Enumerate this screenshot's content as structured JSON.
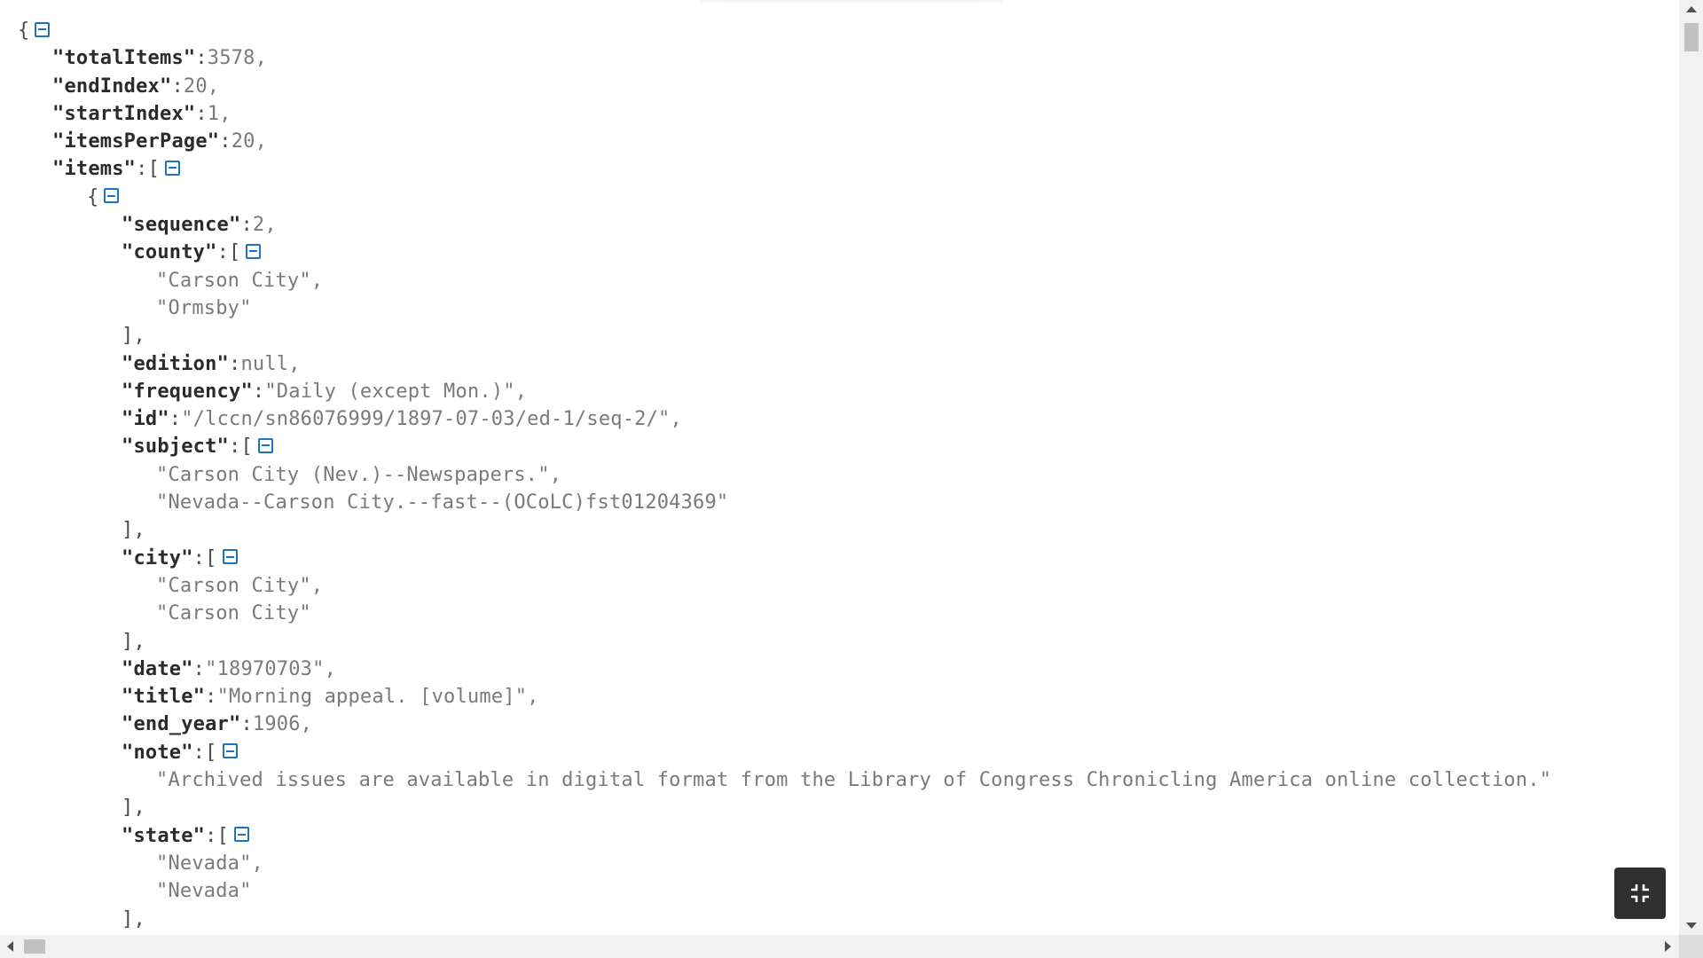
{
  "json_view": {
    "lines": [
      {
        "indent": 0,
        "k": "",
        "colon": "",
        "v": "{",
        "toggle": true
      },
      {
        "indent": 1,
        "k": "\"totalItems\"",
        "colon": ":",
        "v": "3578,",
        "toggle": false
      },
      {
        "indent": 1,
        "k": "\"endIndex\"",
        "colon": ":",
        "v": "20,",
        "toggle": false
      },
      {
        "indent": 1,
        "k": "\"startIndex\"",
        "colon": ":",
        "v": "1,",
        "toggle": false
      },
      {
        "indent": 1,
        "k": "\"itemsPerPage\"",
        "colon": ":",
        "v": "20,",
        "toggle": false
      },
      {
        "indent": 1,
        "k": "\"items\"",
        "colon": ":",
        "v": "[",
        "toggle": true
      },
      {
        "indent": 2,
        "k": "",
        "colon": "",
        "v": "{",
        "toggle": true
      },
      {
        "indent": 3,
        "k": "\"sequence\"",
        "colon": ":",
        "v": "2,",
        "toggle": false
      },
      {
        "indent": 3,
        "k": "\"county\"",
        "colon": ":",
        "v": "[",
        "toggle": true
      },
      {
        "indent": 4,
        "k": "",
        "colon": "",
        "v": "\"Carson City\",",
        "toggle": false
      },
      {
        "indent": 4,
        "k": "",
        "colon": "",
        "v": "\"Ormsby\"",
        "toggle": false
      },
      {
        "indent": 3,
        "k": "",
        "colon": "",
        "v": "],",
        "toggle": false
      },
      {
        "indent": 3,
        "k": "\"edition\"",
        "colon": ":",
        "v": "null,",
        "toggle": false
      },
      {
        "indent": 3,
        "k": "\"frequency\"",
        "colon": ":",
        "v": "\"Daily (except Mon.)\",",
        "toggle": false
      },
      {
        "indent": 3,
        "k": "\"id\"",
        "colon": ":",
        "v": "\"/lccn/sn86076999/1897-07-03/ed-1/seq-2/\",",
        "toggle": false
      },
      {
        "indent": 3,
        "k": "\"subject\"",
        "colon": ":",
        "v": "[",
        "toggle": true
      },
      {
        "indent": 4,
        "k": "",
        "colon": "",
        "v": "\"Carson City (Nev.)--Newspapers.\",",
        "toggle": false
      },
      {
        "indent": 4,
        "k": "",
        "colon": "",
        "v": "\"Nevada--Carson City.--fast--(OCoLC)fst01204369\"",
        "toggle": false
      },
      {
        "indent": 3,
        "k": "",
        "colon": "",
        "v": "],",
        "toggle": false
      },
      {
        "indent": 3,
        "k": "\"city\"",
        "colon": ":",
        "v": "[",
        "toggle": true
      },
      {
        "indent": 4,
        "k": "",
        "colon": "",
        "v": "\"Carson City\",",
        "toggle": false
      },
      {
        "indent": 4,
        "k": "",
        "colon": "",
        "v": "\"Carson City\"",
        "toggle": false
      },
      {
        "indent": 3,
        "k": "",
        "colon": "",
        "v": "],",
        "toggle": false
      },
      {
        "indent": 3,
        "k": "\"date\"",
        "colon": ":",
        "v": "\"18970703\",",
        "toggle": false
      },
      {
        "indent": 3,
        "k": "\"title\"",
        "colon": ":",
        "v": "\"Morning appeal. [volume]\",",
        "toggle": false
      },
      {
        "indent": 3,
        "k": "\"end_year\"",
        "colon": ":",
        "v": "1906,",
        "toggle": false
      },
      {
        "indent": 3,
        "k": "\"note\"",
        "colon": ":",
        "v": "[",
        "toggle": true
      },
      {
        "indent": 4,
        "k": "",
        "colon": "",
        "v": "\"Archived issues are available in digital format from the Library of Congress Chronicling America online collection.\"",
        "toggle": false
      },
      {
        "indent": 3,
        "k": "",
        "colon": "",
        "v": "],",
        "toggle": false
      },
      {
        "indent": 3,
        "k": "\"state\"",
        "colon": ":",
        "v": "[",
        "toggle": true
      },
      {
        "indent": 4,
        "k": "",
        "colon": "",
        "v": "\"Nevada\",",
        "toggle": false
      },
      {
        "indent": 4,
        "k": "",
        "colon": "",
        "v": "\"Nevada\"",
        "toggle": false
      },
      {
        "indent": 3,
        "k": "",
        "colon": "",
        "v": "],",
        "toggle": false
      }
    ]
  },
  "controls": {
    "collapse_icon": "minus-square-icon",
    "exit_fullscreen_icon": "exit-fullscreen-icon"
  },
  "colors": {
    "key": "#2b2b2b",
    "value": "#7a7a7a",
    "toggle": "#1e73be",
    "fullscreen_button": "#2f2f2f"
  }
}
